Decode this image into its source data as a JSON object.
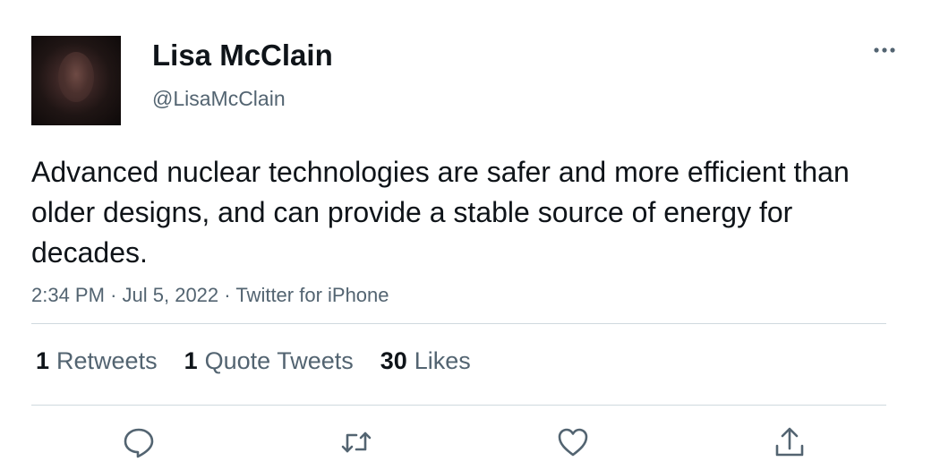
{
  "author": {
    "display_name": "Lisa McClain",
    "handle": "@LisaMcClain"
  },
  "tweet": {
    "text": "Advanced nuclear technologies are safer and more efficient than older designs, and can provide a stable source of energy for decades.",
    "time": "2:34 PM",
    "date": "Jul 5, 2022",
    "source": "Twitter for iPhone",
    "separator": "·"
  },
  "stats": {
    "retweets": {
      "count": "1",
      "label": "Retweets"
    },
    "quotes": {
      "count": "1",
      "label": "Quote Tweets"
    },
    "likes": {
      "count": "30",
      "label": "Likes"
    }
  },
  "actions": {
    "reply": "reply-icon",
    "retweet": "retweet-icon",
    "like": "heart-icon",
    "share": "share-icon"
  },
  "colors": {
    "text_primary": "#0f1419",
    "text_secondary": "#536471",
    "divider": "#cfd9de"
  }
}
